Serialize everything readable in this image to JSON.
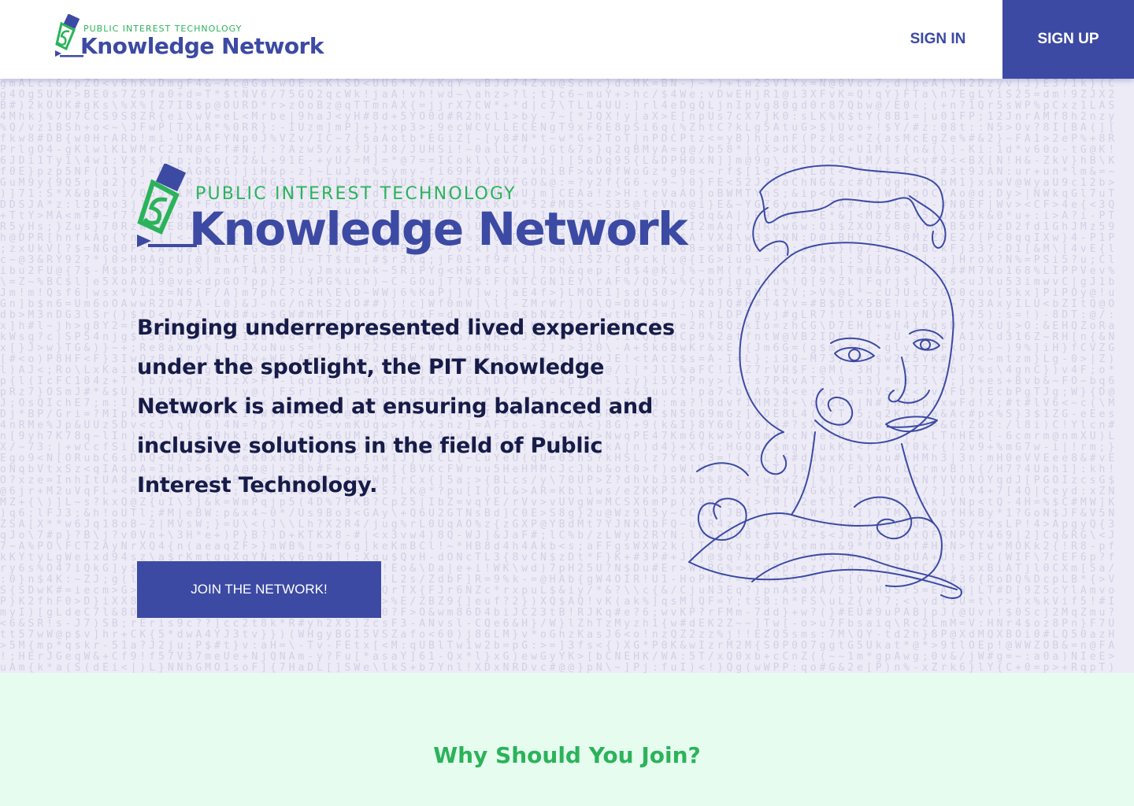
{
  "brand": {
    "kicker": "PUBLIC INTEREST TECHNOLOGY",
    "name": "Knowledge Network",
    "colors": {
      "primary": "#3c4aa3",
      "accent": "#2bb35a",
      "text": "#161b48",
      "section_bg": "#e6fcef"
    }
  },
  "nav": {
    "sign_in": "SIGN IN",
    "sign_up": "SIGN UP"
  },
  "hero": {
    "description": "Bringing underrepresented lived experiences under the spotlight, the PIT Knowledge Network is aimed at ensuring balanced and inclusive solutions in the field of Public Interest Technology.",
    "cta": "JOIN THE NETWORK!",
    "illustration": "line-art-face-icon"
  },
  "why": {
    "title": "Why Should You Join?"
  }
}
